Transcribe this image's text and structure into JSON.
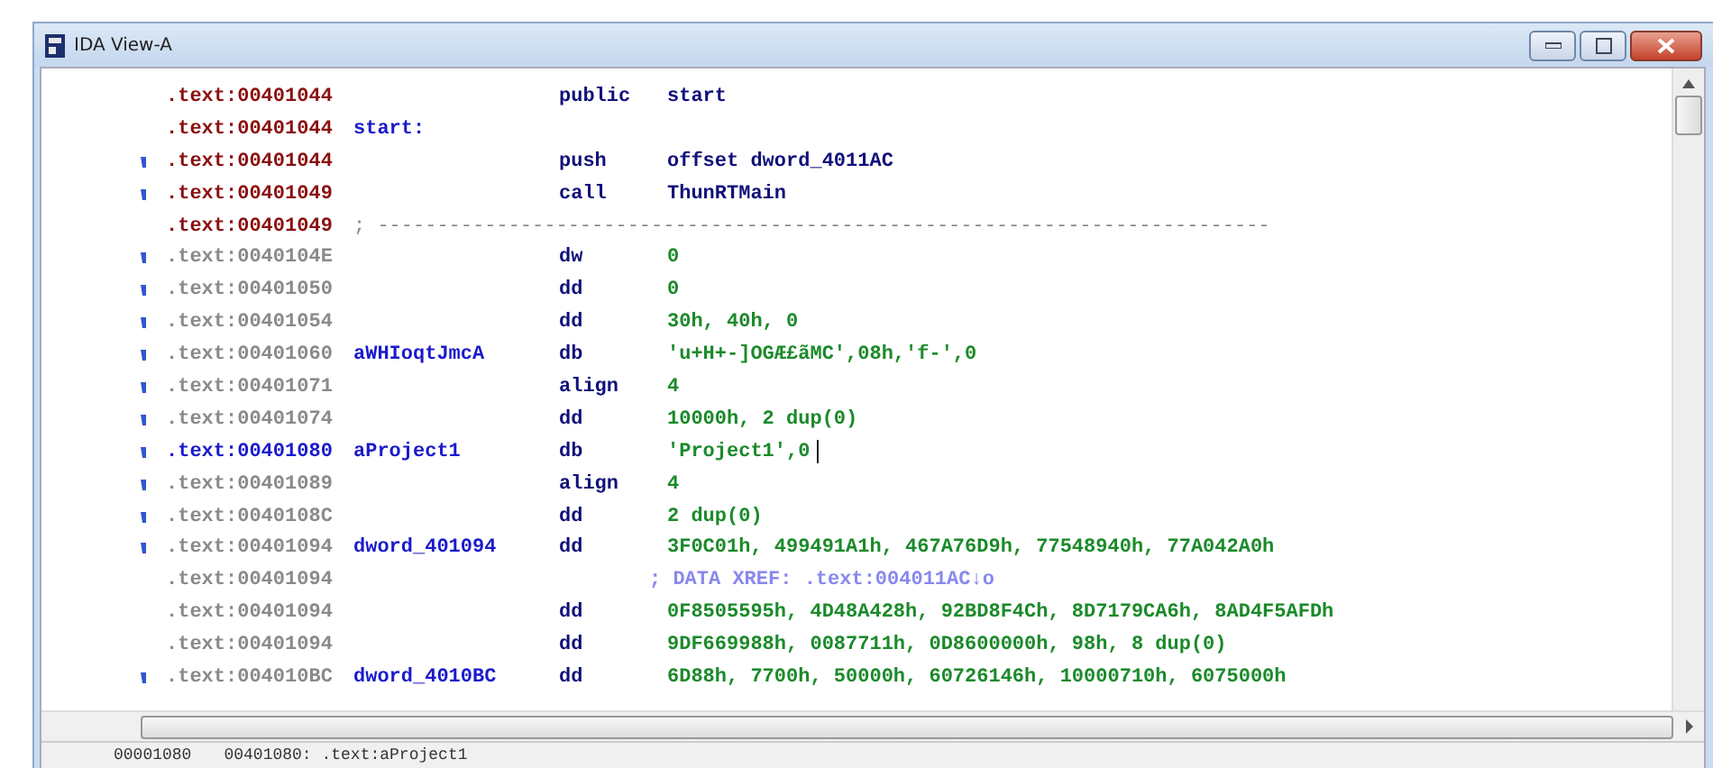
{
  "window": {
    "title": "IDA View-A"
  },
  "lines": [
    {
      "kind": "code",
      "marker": false,
      "selected": false,
      "cursor": false,
      "address": ".text:00401044",
      "mnemonic": "public",
      "operands": "start"
    },
    {
      "kind": "code",
      "marker": false,
      "selected": false,
      "cursor": false,
      "address": ".text:00401044",
      "label": "start:"
    },
    {
      "kind": "code",
      "marker": true,
      "selected": false,
      "cursor": false,
      "address": ".text:00401044",
      "mnemonic": "push",
      "operands": "offset dword_4011AC"
    },
    {
      "kind": "code",
      "marker": true,
      "selected": false,
      "cursor": false,
      "address": ".text:00401049",
      "mnemonic": "call",
      "operands": "ThunRTMain"
    },
    {
      "kind": "separator",
      "marker": false,
      "selected": false,
      "cursor": false,
      "address": ".text:00401049",
      "comment": "; ---------------------------------------------------------------------------"
    },
    {
      "kind": "data",
      "marker": true,
      "selected": false,
      "cursor": false,
      "address": ".text:0040104E",
      "mnemonic": "dw",
      "operands": "0"
    },
    {
      "kind": "data",
      "marker": true,
      "selected": false,
      "cursor": false,
      "address": ".text:00401050",
      "mnemonic": "dd",
      "operands": "0"
    },
    {
      "kind": "data",
      "marker": true,
      "selected": false,
      "cursor": false,
      "address": ".text:00401054",
      "mnemonic": "dd",
      "operands": "30h, 40h, 0"
    },
    {
      "kind": "data",
      "marker": true,
      "selected": false,
      "cursor": false,
      "address": ".text:00401060",
      "label": "aWHIoqtJmcA",
      "mnemonic": "db",
      "operands": "'u+H+-]OGÆ£ãMC',08h,'f-',0"
    },
    {
      "kind": "data",
      "marker": true,
      "selected": false,
      "cursor": false,
      "address": ".text:00401071",
      "mnemonic": "align",
      "operands": "4"
    },
    {
      "kind": "data",
      "marker": true,
      "selected": false,
      "cursor": false,
      "address": ".text:00401074",
      "mnemonic": "dd",
      "operands": "10000h, 2 dup(0)"
    },
    {
      "kind": "data",
      "marker": true,
      "selected": true,
      "cursor": true,
      "address": ".text:00401080",
      "label": "aProject1",
      "mnemonic": "db",
      "operands": "'Project1',0"
    },
    {
      "kind": "data",
      "marker": true,
      "selected": false,
      "cursor": false,
      "address": ".text:00401089",
      "mnemonic": "align",
      "operands": "4"
    },
    {
      "kind": "data",
      "marker": true,
      "selected": false,
      "cursor": false,
      "address": ".text:0040108C",
      "mnemonic": "dd",
      "operands": "2 dup(0)"
    },
    {
      "kind": "data",
      "marker": true,
      "selected": false,
      "cursor": false,
      "address": ".text:00401094",
      "label": "dword_401094",
      "mnemonic": "dd",
      "operands": "3F0C01h, 499491A1h, 467A76D9h, 77548940h, 77A042A0h"
    },
    {
      "kind": "xref",
      "marker": false,
      "selected": false,
      "cursor": false,
      "address": ".text:00401094",
      "comment": "; DATA XREF: .text:004011AC↓o"
    },
    {
      "kind": "data",
      "marker": false,
      "selected": false,
      "cursor": false,
      "address": ".text:00401094",
      "mnemonic": "dd",
      "operands": "0F8505595h, 4D48A428h, 92BD8F4Ch, 8D7179CA6h, 8AD4F5AFDh"
    },
    {
      "kind": "data",
      "marker": false,
      "selected": false,
      "cursor": false,
      "address": ".text:00401094",
      "mnemonic": "dd",
      "operands": "9DF669988h, 0087711h, 0D8600000h, 98h, 8 dup(0)"
    },
    {
      "kind": "data",
      "marker": true,
      "selected": false,
      "cursor": false,
      "address": ".text:004010BC",
      "label": "dword_4010BC",
      "mnemonic": "dd",
      "operands": "6D88h, 7700h, 50000h, 60726146h, 10000710h, 6075000h"
    }
  ],
  "status_bar": [
    "00001080",
    "00401080: .text:aProject1"
  ]
}
